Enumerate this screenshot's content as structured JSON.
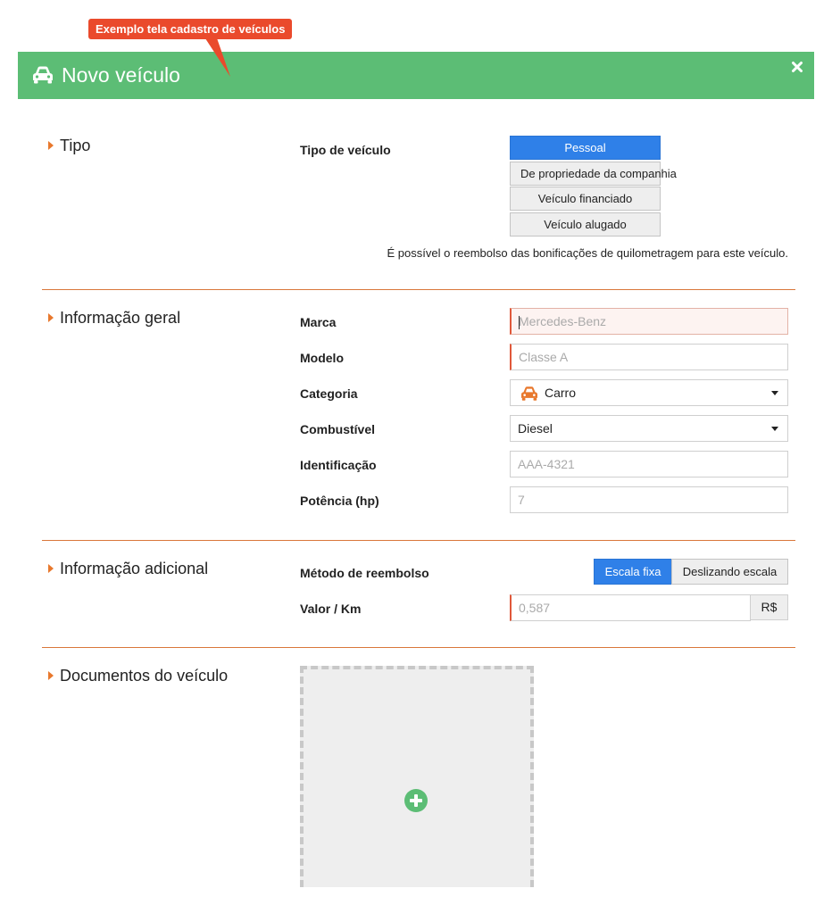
{
  "callout": {
    "text": "Exemplo tela cadastro de veículos"
  },
  "header": {
    "title": "Novo veículo",
    "icon": "car-icon",
    "close_icon": "close-icon",
    "color": "#5cbd75"
  },
  "sections": {
    "tipo": {
      "title": "Tipo",
      "label": "Tipo de veículo",
      "options": [
        "Pessoal",
        "De propriedade da companhia",
        "Veículo financiado",
        "Veículo alugado"
      ],
      "selected": "Pessoal",
      "note": "É possível o reembolso das bonificações de quilometragem para este veículo."
    },
    "geral": {
      "title": "Informação geral",
      "marca": {
        "label": "Marca",
        "placeholder": "Mercedes-Benz"
      },
      "modelo": {
        "label": "Modelo",
        "placeholder": "Classe A"
      },
      "categoria": {
        "label": "Categoria",
        "value": "Carro",
        "icon": "car-icon"
      },
      "combustivel": {
        "label": "Combustível",
        "value": "Diesel"
      },
      "identificacao": {
        "label": "Identificação",
        "placeholder": "AAA-4321"
      },
      "potencia": {
        "label": "Potência (hp)",
        "placeholder": "7"
      }
    },
    "adicional": {
      "title": "Informação adicional",
      "metodo": {
        "label": "Método de reembolso",
        "options": [
          "Escala fixa",
          "Deslizando escala"
        ],
        "selected": "Escala fixa"
      },
      "valor": {
        "label": "Valor / Km",
        "placeholder": "0,587",
        "currency": "R$"
      }
    },
    "documentos": {
      "title": "Documentos do veículo",
      "add_icon": "plus-circle-icon"
    }
  },
  "colors": {
    "accent": "#e8782d",
    "primary": "#2f80e8",
    "required": "#e0583a",
    "callout": "#ea4a2c",
    "success": "#5cbd75"
  }
}
